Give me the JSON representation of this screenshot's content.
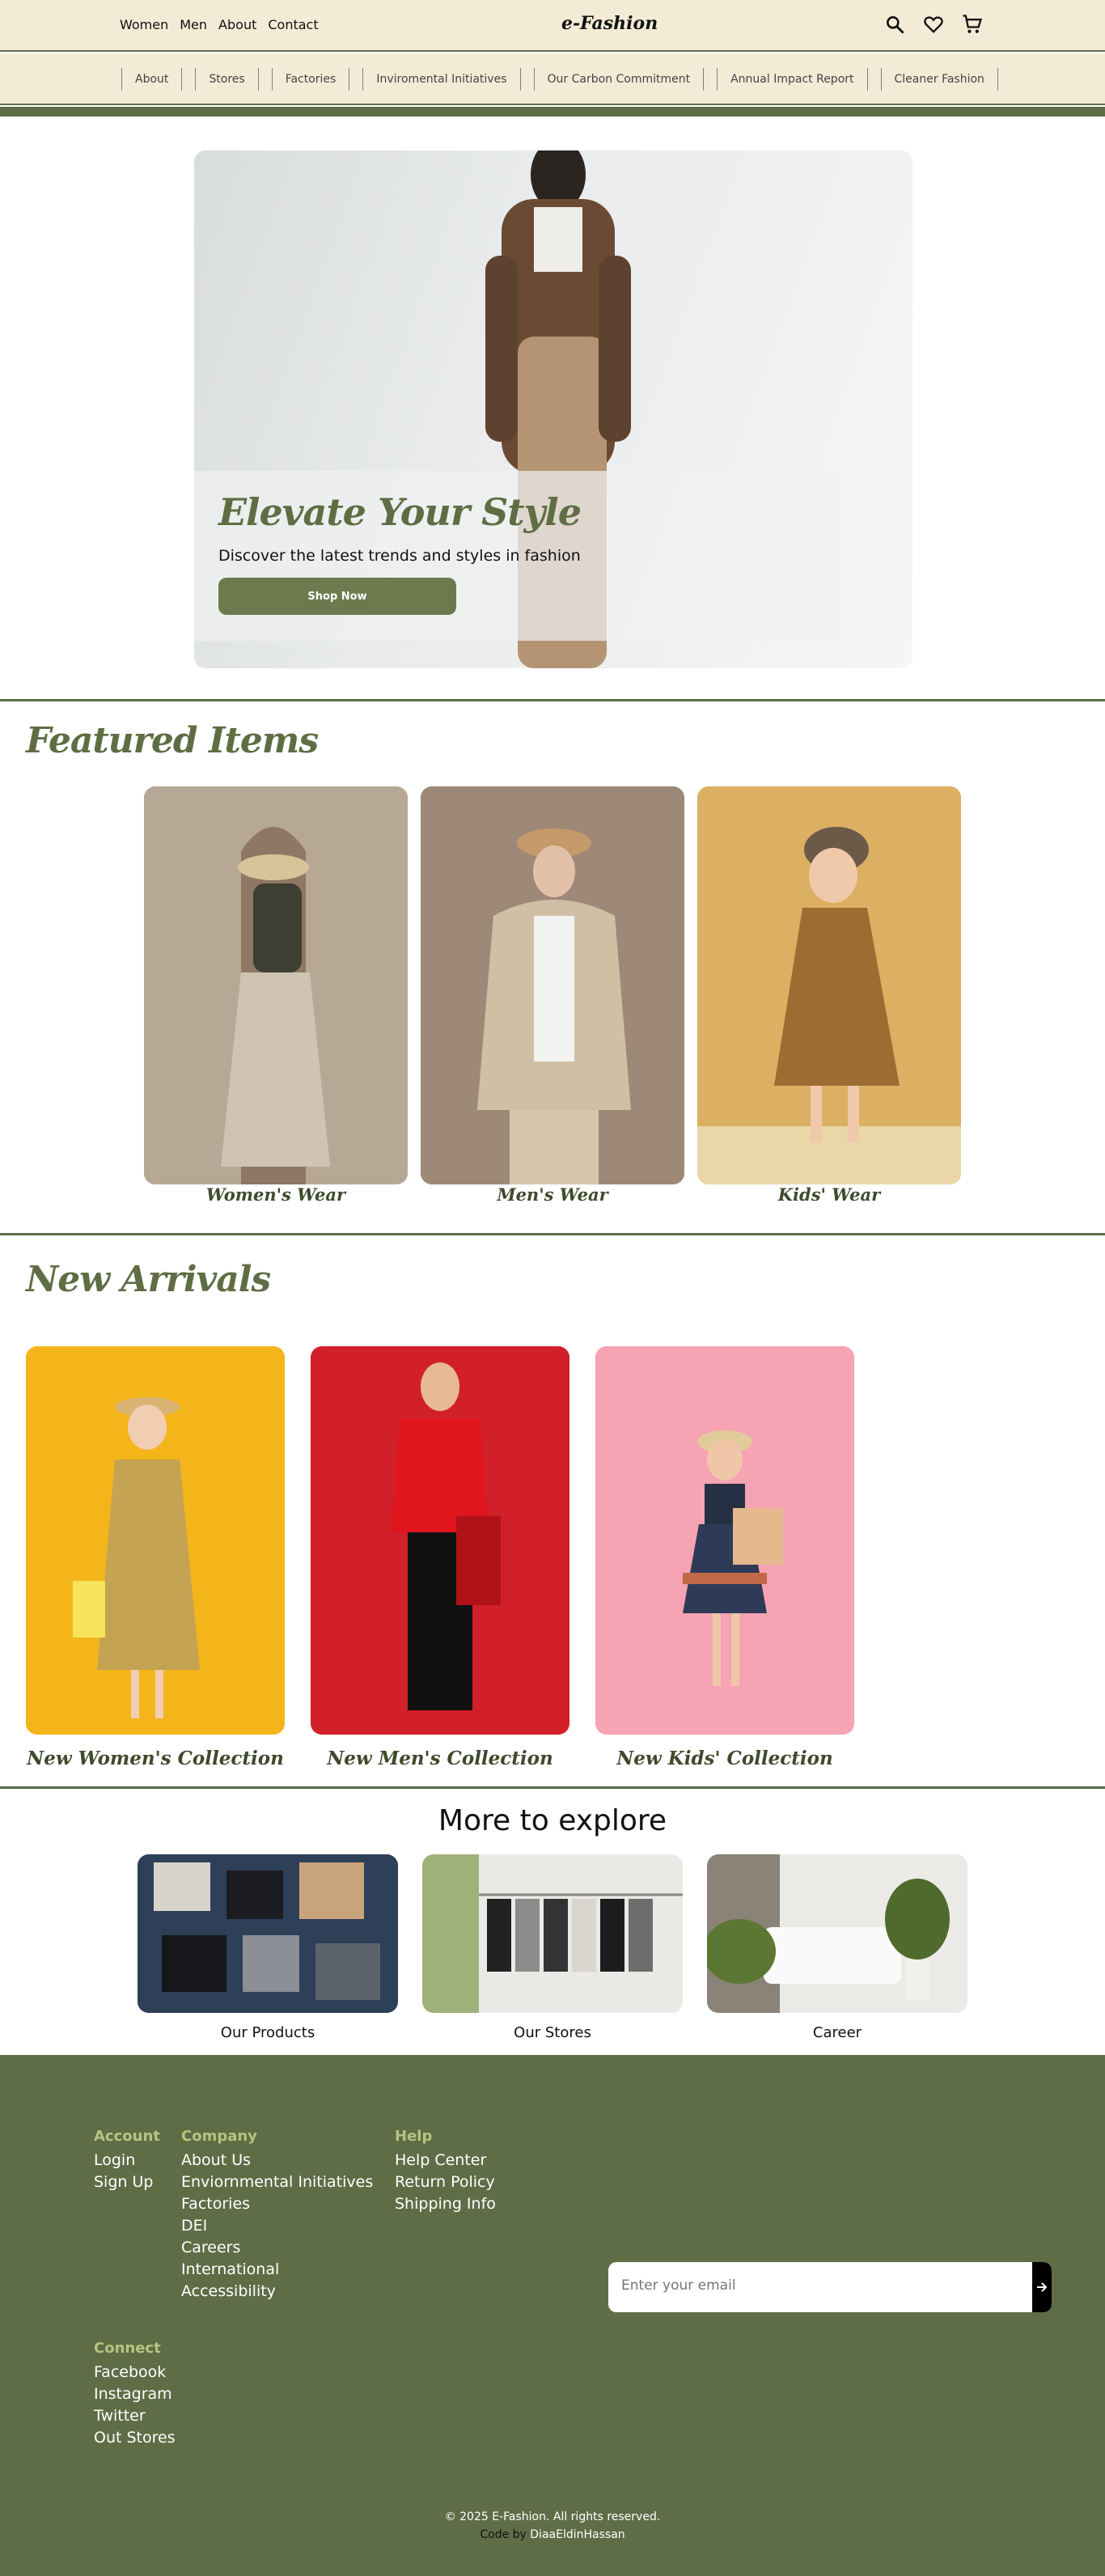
{
  "header": {
    "nav": [
      "Women",
      "Men",
      "About",
      "Contact"
    ],
    "brand": "e-Fashion",
    "icons": [
      "search-icon",
      "heart-icon",
      "cart-icon"
    ]
  },
  "subnav": [
    "About",
    "Stores",
    "Factories",
    "Inviromental Initiatives",
    "Our Carbon Commitment",
    "Annual Impact Report",
    "Cleaner Fashion"
  ],
  "hero": {
    "title": "Elevate Your Style",
    "subtitle": "Discover the latest trends and styles in fashion",
    "button": "Shop Now"
  },
  "featured": {
    "title": "Featured Items",
    "items": [
      {
        "label": "Women's Wear",
        "color": "#b8a895"
      },
      {
        "label": "Men's Wear",
        "color": "#a08a77"
      },
      {
        "label": "Kids' Wear",
        "color": "#d9ad63"
      }
    ]
  },
  "arrivals": {
    "title": "New Arrivals",
    "items": [
      {
        "label": "New Women's Collection",
        "color": "#f3b51b"
      },
      {
        "label": "New Men's Collection",
        "color": "#d61f26"
      },
      {
        "label": "New Kids' Collection",
        "color": "#f5a6b5"
      }
    ]
  },
  "explore": {
    "title": "More to explore",
    "items": [
      {
        "label": "Our Products",
        "color": "#2d3f57"
      },
      {
        "label": "Our Stores",
        "color": "#e6e3de"
      },
      {
        "label": "Career",
        "color": "#e9e7e4"
      }
    ]
  },
  "footer": {
    "account": {
      "title": "Account",
      "links": [
        "Login",
        "Sign Up"
      ]
    },
    "company": {
      "title": "Company",
      "links": [
        "About Us",
        "Enviornmental Initiatives",
        "Factories",
        "DEI",
        "Careers",
        "International",
        "Accessibility"
      ]
    },
    "help": {
      "title": "Help",
      "links": [
        "Help Center",
        "Return Policy",
        "Shipping Info"
      ]
    },
    "connect": {
      "title": "Connect",
      "links": [
        "Facebook",
        "Instagram",
        "Twitter",
        "Out Stores"
      ]
    },
    "email_placeholder": "Enter your email",
    "copyright": "© 2025 E-Fashion. All rights reserved.",
    "code_by_prefix": "Code by",
    "code_by_name": "DiaaEldinHassan"
  },
  "colors": {
    "accent": "#5f6d46",
    "cream": "#f4ebd6",
    "footer_head": "#b4c580"
  }
}
